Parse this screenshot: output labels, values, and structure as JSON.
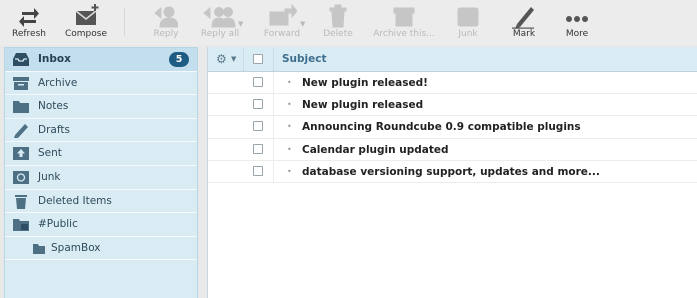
{
  "toolbar": {
    "refresh": "Refresh",
    "compose": "Compose",
    "reply": "Reply",
    "reply_all": "Reply all",
    "forward": "Forward",
    "delete": "Delete",
    "archive": "Archive this...",
    "junk": "Junk",
    "mark": "Mark",
    "more": "More"
  },
  "folders": [
    {
      "label": "Inbox",
      "icon": "inbox-icon",
      "count": "5"
    },
    {
      "label": "Archive",
      "icon": "archive-icon"
    },
    {
      "label": "Notes",
      "icon": "folder-icon"
    },
    {
      "label": "Drafts",
      "icon": "pencil-icon"
    },
    {
      "label": "Sent",
      "icon": "sent-icon"
    },
    {
      "label": "Junk",
      "icon": "recycle-icon"
    },
    {
      "label": "Deleted Items",
      "icon": "trash-icon"
    },
    {
      "label": "#Public",
      "icon": "shared-folder-icon"
    },
    {
      "label": "SpamBox",
      "icon": "folder-icon"
    }
  ],
  "list": {
    "subject_header": "Subject",
    "messages": [
      {
        "subject": "New plugin released!"
      },
      {
        "subject": "New plugin released"
      },
      {
        "subject": "Announcing Roundcube 0.9 compatible plugins"
      },
      {
        "subject": "Calendar plugin updated"
      },
      {
        "subject": "database versioning support, updates and more..."
      }
    ]
  },
  "colors": {
    "accent": "#1e5c84",
    "folder_bg": "#d9ecf4",
    "selected_bg": "#c3dfee"
  }
}
